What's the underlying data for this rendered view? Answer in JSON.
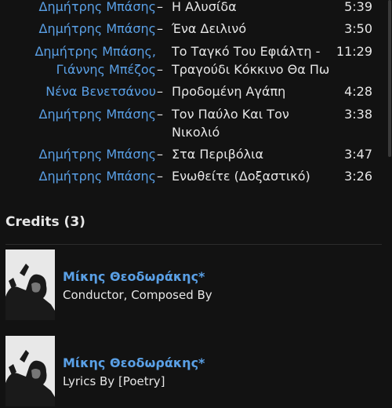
{
  "tracklist": [
    {
      "artist_lines": [
        "Δημήτρης Μπάσης"
      ],
      "title_lines": [
        "Η Αλυσίδα"
      ],
      "duration": "5:39"
    },
    {
      "artist_lines": [
        "Δημήτρης Μπάσης"
      ],
      "title_lines": [
        "Ένα Δειλινό"
      ],
      "duration": "3:50"
    },
    {
      "artist_lines": [
        "Δημήτρης Μπάσης,",
        "Γιάννης Μπέζος"
      ],
      "title_lines": [
        "Το Ταγκό Του Εφιάλτη -",
        "Τραγούδι Κόκκινο Θα Πω"
      ],
      "duration": "11:29"
    },
    {
      "artist_lines": [
        "Νένα Βενετσάνου"
      ],
      "title_lines": [
        "Προδομένη Αγάπη"
      ],
      "duration": "4:28"
    },
    {
      "artist_lines": [
        "Δημήτρης Μπάσης"
      ],
      "title_lines": [
        "Τον Παύλο Και Τον",
        "Νικολιό"
      ],
      "duration": "3:38"
    },
    {
      "artist_lines": [
        "Δημήτρης Μπάσης"
      ],
      "title_lines": [
        "Στα Περιβόλια"
      ],
      "duration": "3:47"
    },
    {
      "artist_lines": [
        "Δημήτρης Μπάσης"
      ],
      "title_lines": [
        "Ενωθείτε (Δοξαστικό)"
      ],
      "duration": "3:26"
    }
  ],
  "dash": "–",
  "credits": {
    "heading": "Credits (3)",
    "items": [
      {
        "name": "Μίκης Θεοδωράκης*",
        "role": "Conductor, Composed By"
      },
      {
        "name": "Μίκης Θεοδωράκης*",
        "role": "Lyrics By [Poetry]"
      }
    ]
  },
  "colors": {
    "background": "#121212",
    "link": "#5aa0e6",
    "text": "#e6e6e6"
  }
}
